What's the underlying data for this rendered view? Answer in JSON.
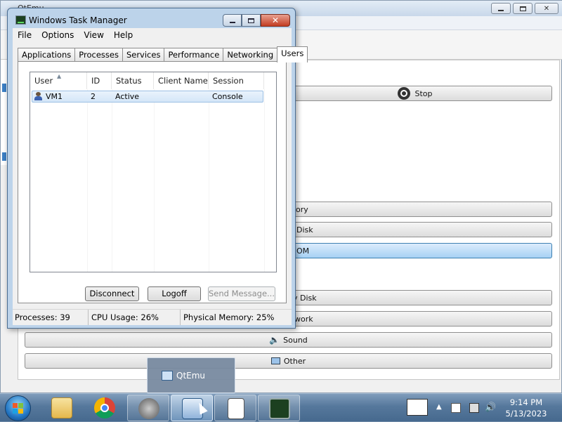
{
  "qtemu": {
    "title": "QtEmu",
    "buttons": {
      "stop": "Stop",
      "memory": "ory",
      "hard_disk": "Disk",
      "cdrom": "OM",
      "floppy": "y Disk",
      "network": "work",
      "sound": "Sound",
      "other": "Other"
    }
  },
  "task_manager": {
    "title": "Windows Task Manager",
    "menu": [
      "File",
      "Options",
      "View",
      "Help"
    ],
    "tabs": [
      "Applications",
      "Processes",
      "Services",
      "Performance",
      "Networking",
      "Users"
    ],
    "selected_tab": "Users",
    "columns": [
      "User",
      "ID",
      "Status",
      "Client Name",
      "Session"
    ],
    "rows": [
      {
        "user": "VM1",
        "id": "2",
        "status": "Active",
        "client_name": "",
        "session": "Console"
      }
    ],
    "buttons": {
      "disconnect": "Disconnect",
      "logoff": "Logoff",
      "send_message": "Send Message..."
    },
    "status": {
      "processes": "Processes: 39",
      "cpu": "CPU Usage: 26%",
      "memory": "Physical Memory: 25%"
    }
  },
  "taskbar": {
    "thumbnail_label": "QtEmu",
    "clock_time": "9:14 PM",
    "clock_date": "5/13/2023"
  },
  "colors": {
    "accent_selection": "#d4e6f8",
    "close_button": "#c33c22",
    "taskbar": "#56789c"
  }
}
